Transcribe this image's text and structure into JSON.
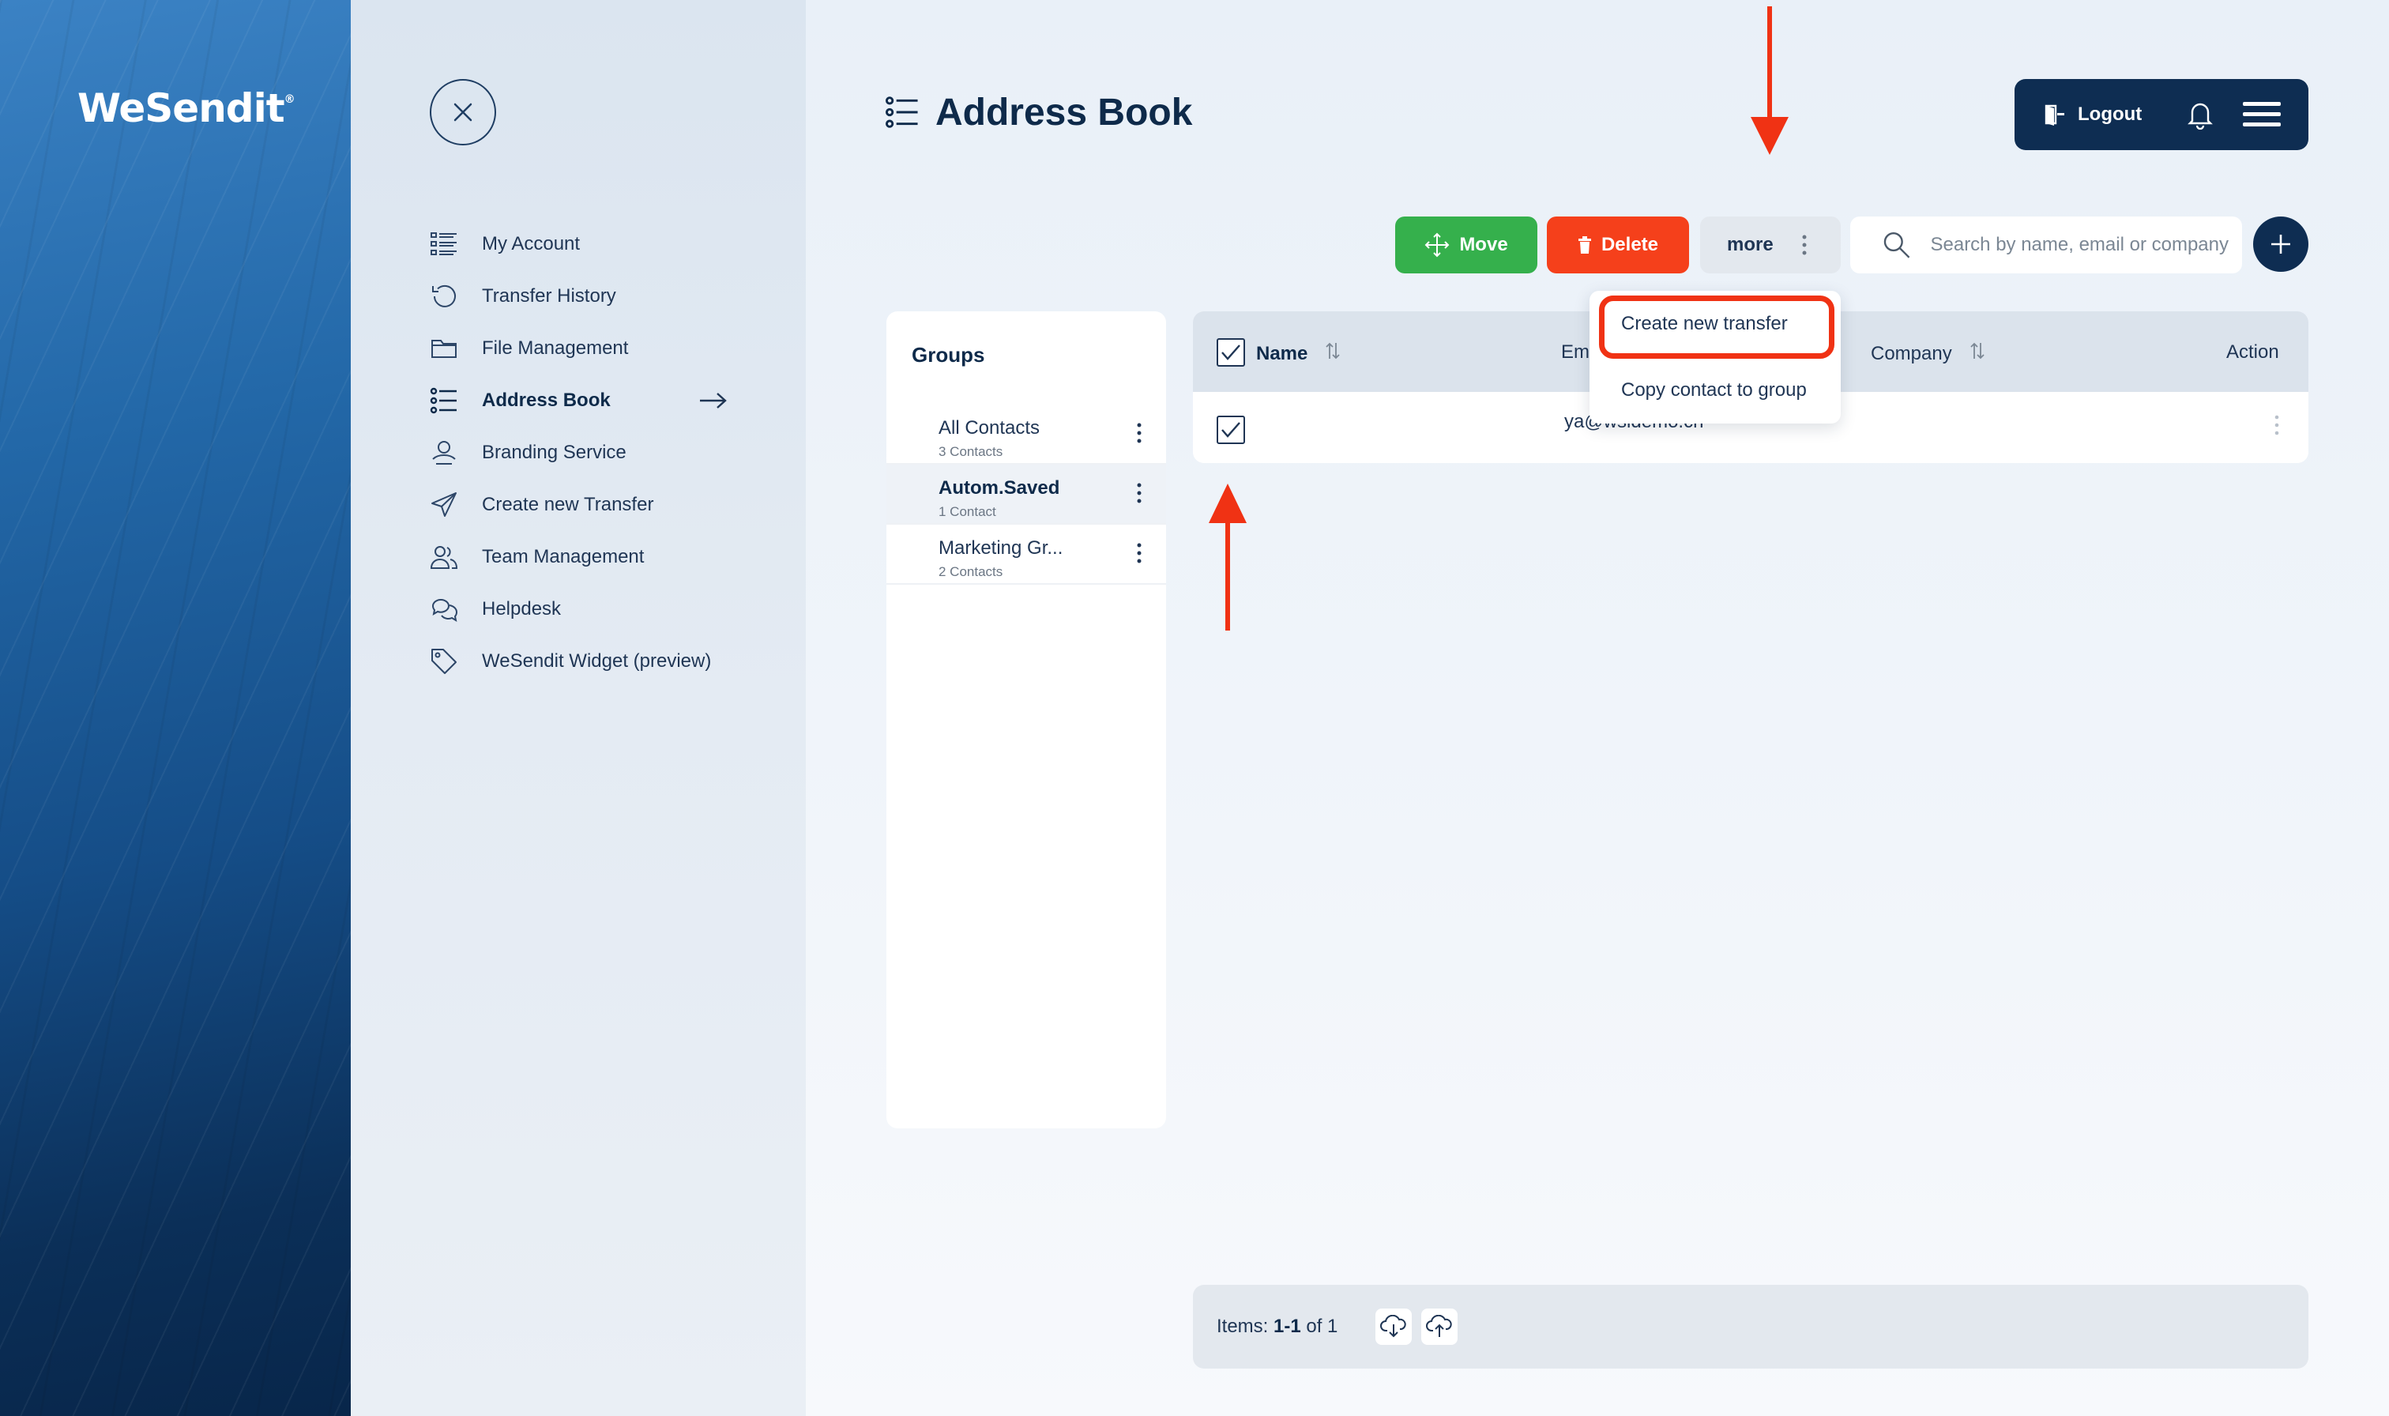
{
  "brand": {
    "logo": "WeSendit",
    "logo_mark": "®"
  },
  "side_menu": {
    "items": [
      {
        "label": "My Account",
        "icon": "list-icon"
      },
      {
        "label": "Transfer History",
        "icon": "history-icon"
      },
      {
        "label": "File Management",
        "icon": "folder-icon"
      },
      {
        "label": "Address Book",
        "icon": "address-list-icon",
        "active": true
      },
      {
        "label": "Branding Service",
        "icon": "branding-icon"
      },
      {
        "label": "Create new Transfer",
        "icon": "paper-plane-icon"
      },
      {
        "label": "Team Management",
        "icon": "team-icon"
      },
      {
        "label": "Helpdesk",
        "icon": "chat-icon"
      },
      {
        "label": "WeSendit Widget (preview)",
        "icon": "tag-icon"
      }
    ]
  },
  "header": {
    "title": "Address Book",
    "logout_label": "Logout"
  },
  "toolbar": {
    "move_label": "Move",
    "delete_label": "Delete",
    "more_label": "more",
    "search_placeholder": "Search by name, email or company"
  },
  "groups": {
    "title": "Groups",
    "items": [
      {
        "name": "All Contacts",
        "count": "3 Contacts"
      },
      {
        "name": "Autom.Saved",
        "count": "1 Contact",
        "active": true
      },
      {
        "name": "Marketing Gr...",
        "count": "2 Contacts"
      }
    ]
  },
  "table": {
    "columns": {
      "name": "Name",
      "email": "Em",
      "company": "Company",
      "action": "Action"
    },
    "rows": [
      {
        "name": "",
        "email": "ya@wsldemo.cn",
        "company": "",
        "checked": true
      }
    ]
  },
  "dropdown": {
    "items": [
      "Create new transfer",
      "Copy contact to group"
    ]
  },
  "footer": {
    "items_prefix": "Items: ",
    "items_range": "1-1",
    "items_suffix": " of 1"
  },
  "colors": {
    "navy": "#0e2d52",
    "move_green": "#35b04c",
    "delete_red": "#f5401b",
    "annotation_red": "#f03214"
  }
}
